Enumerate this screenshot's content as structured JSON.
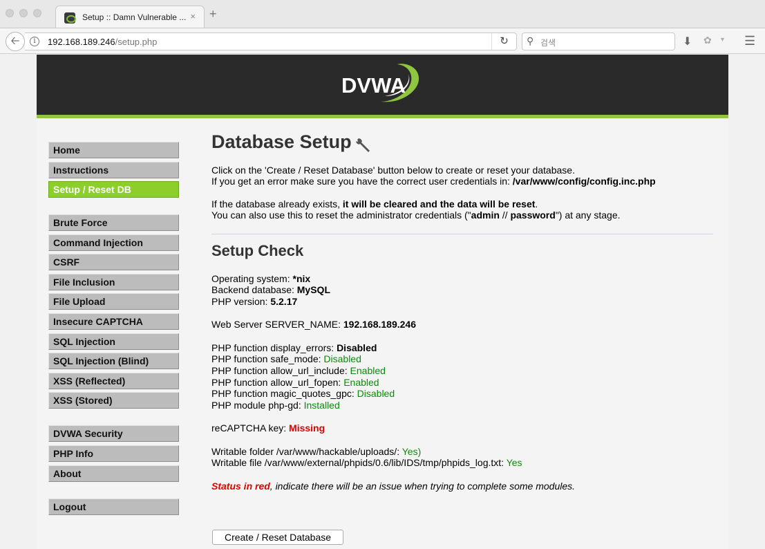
{
  "browser": {
    "tab_title": "Setup :: Damn Vulnerable ...",
    "url_host": "192.168.189.246",
    "url_path": "/setup.php",
    "search_placeholder": "검색",
    "new_tab": "+",
    "close": "×"
  },
  "header": {
    "logo_text": "DVWA"
  },
  "menu": {
    "items": [
      {
        "label": "Home"
      },
      {
        "label": "Instructions"
      },
      {
        "label": "Setup / Reset DB",
        "selected": true
      },
      {
        "label": "Brute Force"
      },
      {
        "label": "Command Injection"
      },
      {
        "label": "CSRF"
      },
      {
        "label": "File Inclusion"
      },
      {
        "label": "File Upload"
      },
      {
        "label": "Insecure CAPTCHA"
      },
      {
        "label": "SQL Injection"
      },
      {
        "label": "SQL Injection (Blind)"
      },
      {
        "label": "XSS (Reflected)"
      },
      {
        "label": "XSS (Stored)"
      },
      {
        "label": "DVWA Security"
      },
      {
        "label": "PHP Info"
      },
      {
        "label": "About"
      },
      {
        "label": "Logout"
      }
    ]
  },
  "main": {
    "title": "Database Setup",
    "intro1": "Click on the 'Create / Reset Database' button below to create or reset your database.",
    "intro2_prefix": "If you get an error make sure you have the correct user credentials in: ",
    "intro2_path": "/var/www/config/config.inc.php",
    "warn1_prefix": "If the database already exists, ",
    "warn1_bold": "it will be cleared and the data will be reset",
    "warn1_suffix": ".",
    "warn2_prefix": "You can also use this to reset the administrator credentials (\"",
    "warn2_user": "admin",
    "warn2_sep": " // ",
    "warn2_pass": "password",
    "warn2_suffix": "\") at any stage.",
    "check_title": "Setup Check",
    "os_label": "Operating system: ",
    "os_value": "*nix",
    "db_label": "Backend database: ",
    "db_value": "MySQL",
    "php_label": "PHP version: ",
    "php_value": "5.2.17",
    "server_label": "Web Server SERVER_NAME: ",
    "server_value": "192.168.189.246",
    "f1_label": "PHP function display_errors: ",
    "f1_value": "Disabled",
    "f2_label": "PHP function safe_mode: ",
    "f2_value": "Disabled",
    "f3_label": "PHP function allow_url_include: ",
    "f3_value": "Enabled",
    "f4_label": "PHP function allow_url_fopen: ",
    "f4_value": "Enabled",
    "f5_label": "PHP function magic_quotes_gpc: ",
    "f5_value": "Disabled",
    "f6_label": "PHP module php-gd: ",
    "f6_value": "Installed",
    "captcha_label": "reCAPTCHA key: ",
    "captcha_value": "Missing",
    "w1_label": "Writable folder /var/www/hackable/uploads/: ",
    "w1_value": "Yes)",
    "w2_label": "Writable file /var/www/external/phpids/0.6/lib/IDS/tmp/phpids_log.txt: ",
    "w2_value": "Yes",
    "note_red": "Status in red",
    "note_rest": ", indicate there will be an issue when trying to complete some modules.",
    "button_label": "Create / Reset Database"
  },
  "colors": {
    "accent": "#8cce2a",
    "ok": "#0a8a0a",
    "error": "#e00000",
    "header_bg": "#2a2a2a"
  }
}
